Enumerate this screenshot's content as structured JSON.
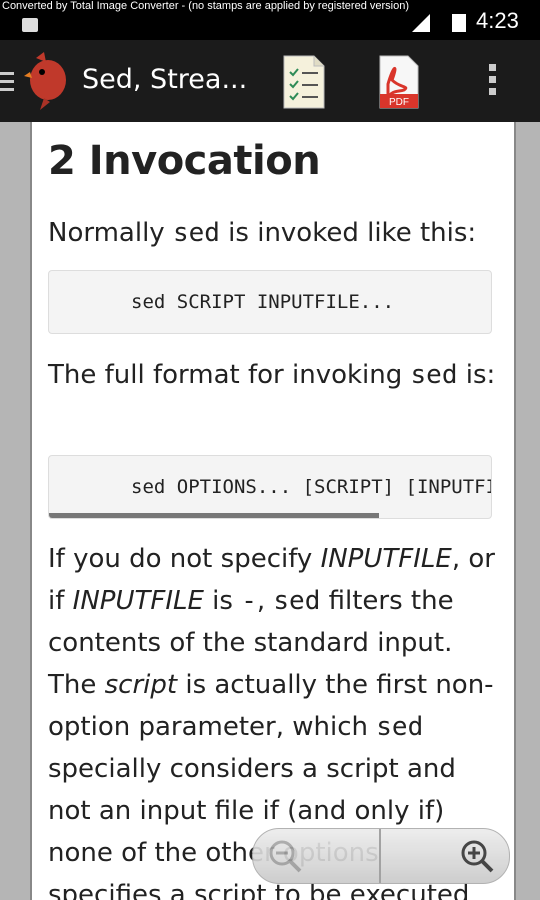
{
  "status_bar": {
    "watermark": "Converted by Total Image Converter - (no stamps are applied by registered version)",
    "time": "4:23"
  },
  "app_bar": {
    "title": "Sed, Strea...",
    "pdf_label": "PDF"
  },
  "content": {
    "heading": "2 Invocation",
    "para1_before": "Normally ",
    "para1_code": "sed",
    "para1_after": " is invoked like this:",
    "code1": "sed SCRIPT INPUTFILE...",
    "para2_before": "The full format for invoking ",
    "para2_code": "sed",
    "para2_after": " is:",
    "code2": "sed OPTIONS... [SCRIPT] [INPUTFILE...]",
    "para3": [
      {
        "t": "text",
        "v": "If you do not specify "
      },
      {
        "t": "em",
        "v": "INPUTFILE"
      },
      {
        "t": "text",
        "v": ", or if "
      },
      {
        "t": "em",
        "v": "INPUTFILE"
      },
      {
        "t": "text",
        "v": " is "
      },
      {
        "t": "code",
        "v": "-"
      },
      {
        "t": "text",
        "v": ", "
      },
      {
        "t": "code",
        "v": "sed"
      },
      {
        "t": "text",
        "v": " filters the contents of the standard input. The "
      },
      {
        "t": "em",
        "v": "script"
      },
      {
        "t": "text",
        "v": " is actually the first non-option parameter, which "
      },
      {
        "t": "code",
        "v": "sed"
      },
      {
        "t": "text",
        "v": " specially considers a script and not an input file if (and only if) none of the other options specifies a script to be executed"
      }
    ]
  },
  "colors": {
    "appbar": "#1b1b1b",
    "logo_red": "#c0392b",
    "pdf_red": "#d9352b"
  },
  "icons": {
    "menu": "menu-icon",
    "logo": "cardinal-bird-icon",
    "toc": "checklist-document-icon",
    "pdf": "pdf-document-icon",
    "overflow": "overflow-menu-icon",
    "zoom_out": "zoom-out-icon",
    "zoom_in": "zoom-in-icon"
  }
}
